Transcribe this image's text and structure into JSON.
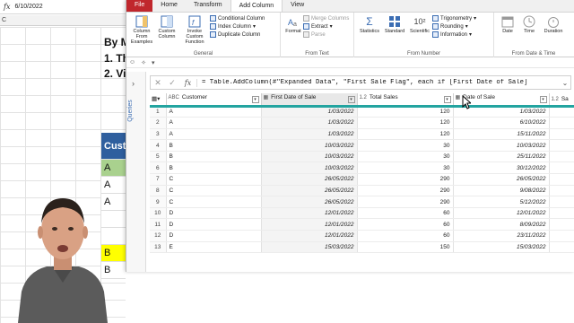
{
  "excel": {
    "formula_fx": "fx",
    "formula_value": "6/10/2022",
    "column_c": "C",
    "text_line1": "By M",
    "text_line2": "1. Th",
    "text_line3": "2. Vi",
    "col_header": "Cust",
    "cells": [
      {
        "text": "A",
        "color": "#a9d18e"
      },
      {
        "text": "A",
        "color": "#ffffff"
      },
      {
        "text": "A",
        "color": "#ffffff"
      },
      {
        "text": "",
        "color": "#ffffff"
      },
      {
        "text": "",
        "color": "#ffffff"
      },
      {
        "text": "B",
        "color": "#ffff00"
      },
      {
        "text": "B",
        "color": "#ffffff"
      }
    ]
  },
  "pq": {
    "tabs": [
      "File",
      "Home",
      "Transform",
      "Add Column",
      "View"
    ],
    "active_tab": "Add Column",
    "ribbon": {
      "general": {
        "label": "General",
        "col_from_examples": "Column From Examples",
        "custom_column": "Custom Column",
        "invoke_custom_function": "Invoke Custom Function",
        "conditional_column": "Conditional Column",
        "index_column": "Index Column",
        "duplicate_column": "Duplicate Column"
      },
      "from_text": {
        "label": "From Text",
        "format": "Format",
        "merge_columns": "Merge Columns",
        "extract": "Extract",
        "parse": "Parse"
      },
      "from_number": {
        "label": "From Number",
        "statistics": "Statistics",
        "standard": "Standard",
        "scientific": "Scientific",
        "trigonometry": "Trigonometry",
        "rounding": "Rounding",
        "information": "Information",
        "sci_glyph": "10²"
      },
      "from_date_time": {
        "label": "From Date & Time",
        "date": "Date",
        "time": "Time",
        "duration": "Duration"
      }
    },
    "queries_label": "Queries",
    "formula": "= Table.AddColumn(#\"Expanded Data\", \"First Sale Flag\", each if [First Date of Sale]",
    "columns": [
      {
        "type": "ABC",
        "name": "Customer"
      },
      {
        "type": "▦",
        "name": "First Date of Sale"
      },
      {
        "type": "1.2",
        "name": "Total Sales"
      },
      {
        "type": "▦",
        "name": "Date of Sale"
      },
      {
        "type": "1.2",
        "name": "Sa"
      }
    ],
    "rows": [
      {
        "n": "1",
        "customer": "A",
        "first_date": "1/03/2022",
        "total": "120",
        "date": "1/03/2022"
      },
      {
        "n": "2",
        "customer": "A",
        "first_date": "1/03/2022",
        "total": "120",
        "date": "6/10/2022"
      },
      {
        "n": "3",
        "customer": "A",
        "first_date": "1/03/2022",
        "total": "120",
        "date": "15/11/2022"
      },
      {
        "n": "4",
        "customer": "B",
        "first_date": "10/03/2022",
        "total": "30",
        "date": "10/03/2022"
      },
      {
        "n": "5",
        "customer": "B",
        "first_date": "10/03/2022",
        "total": "30",
        "date": "25/11/2022"
      },
      {
        "n": "6",
        "customer": "B",
        "first_date": "10/03/2022",
        "total": "30",
        "date": "30/12/2022"
      },
      {
        "n": "7",
        "customer": "C",
        "first_date": "26/05/2022",
        "total": "290",
        "date": "26/05/2022"
      },
      {
        "n": "8",
        "customer": "C",
        "first_date": "26/05/2022",
        "total": "290",
        "date": "9/08/2022"
      },
      {
        "n": "9",
        "customer": "C",
        "first_date": "26/05/2022",
        "total": "290",
        "date": "5/12/2022"
      },
      {
        "n": "10",
        "customer": "D",
        "first_date": "12/01/2022",
        "total": "60",
        "date": "12/01/2022"
      },
      {
        "n": "11",
        "customer": "D",
        "first_date": "12/01/2022",
        "total": "60",
        "date": "8/09/2022"
      },
      {
        "n": "12",
        "customer": "D",
        "first_date": "12/01/2022",
        "total": "60",
        "date": "23/11/2022"
      },
      {
        "n": "13",
        "customer": "E",
        "first_date": "15/03/2022",
        "total": "150",
        "date": "15/03/2022"
      }
    ]
  }
}
